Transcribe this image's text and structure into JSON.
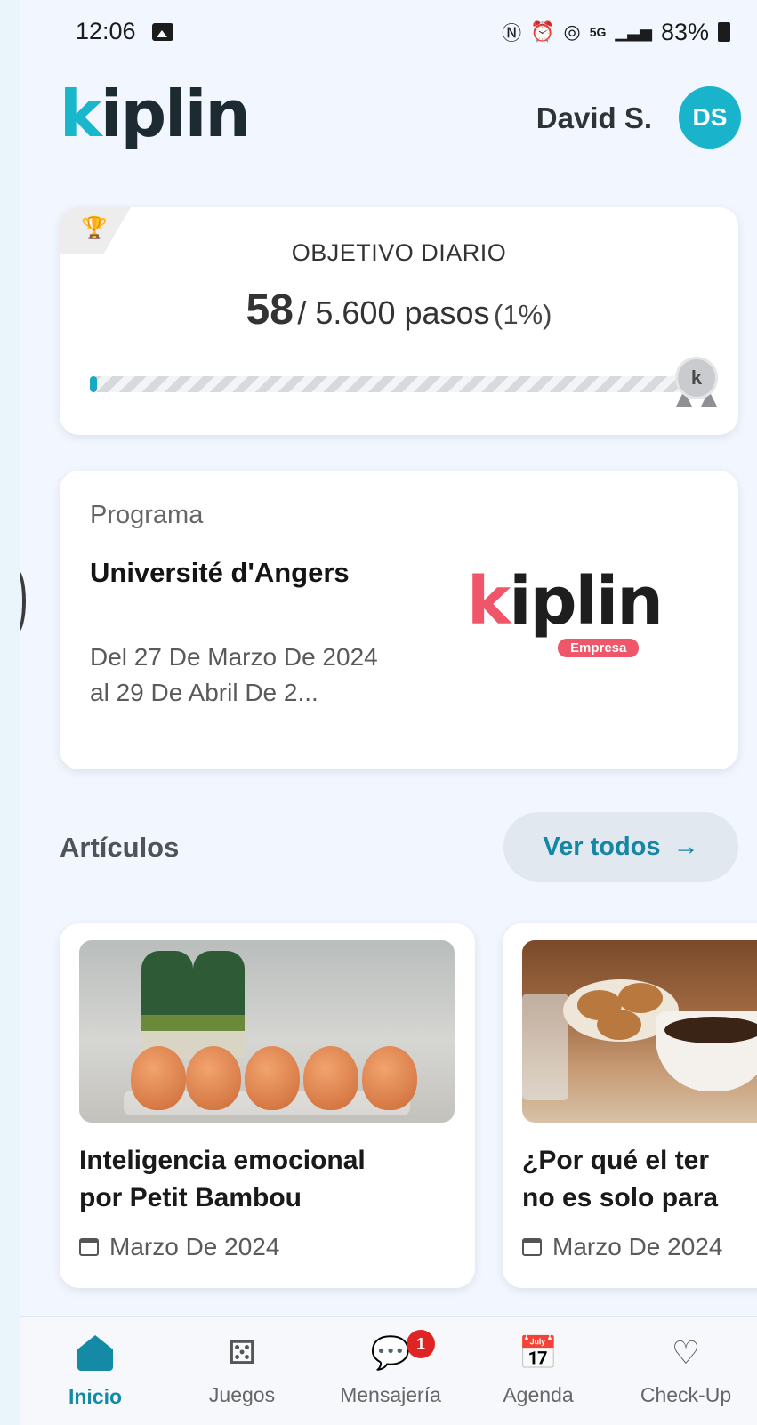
{
  "status_bar": {
    "time": "12:06",
    "battery": "83%",
    "icons": [
      "image-icon",
      "nfc-icon",
      "alarm-icon",
      "hotspot-icon",
      "5g-icon",
      "signal-icon",
      "battery-icon"
    ]
  },
  "header": {
    "logo_k": "k",
    "logo_rest": "iplin",
    "user_name": "David S.",
    "avatar_initials": "DS"
  },
  "goal": {
    "title": "OBJETIVO DIARIO",
    "steps": "58",
    "target_text": "/ 5.600 pasos",
    "percent_text": "(1%)",
    "progress_fraction": 0.01,
    "medal_letter": "k"
  },
  "program": {
    "label": "Programa",
    "name": "Université d'Angers",
    "dates_line1": "Del 27 De Marzo De 2024",
    "dates_line2": "al 29 De Abril De 2...",
    "logo_k": "k",
    "logo_rest": "iplin",
    "logo_badge": "Empresa"
  },
  "articles": {
    "section_title": "Artículos",
    "see_all_label": "Ver todos",
    "items": [
      {
        "title_line1": "Inteligencia emocional",
        "title_line2": "por Petit Bambou",
        "date": "Marzo De 2024"
      },
      {
        "title_line1": "¿Por qué el ter",
        "title_line2": "no es solo para",
        "date": "Marzo De 2024"
      }
    ]
  },
  "nav": {
    "items": [
      {
        "label": "Inicio",
        "icon": "home-icon",
        "active": true
      },
      {
        "label": "Juegos",
        "icon": "dice-icon",
        "active": false
      },
      {
        "label": "Mensajería",
        "icon": "chat-icon",
        "active": false,
        "badge": "1"
      },
      {
        "label": "Agenda",
        "icon": "calendar-icon",
        "active": false
      },
      {
        "label": "Check-Up",
        "icon": "heartbeat-icon",
        "active": false
      }
    ]
  },
  "colors": {
    "accent": "#18b7cc",
    "nav_active": "#148aa6",
    "brand_red": "#f0566a",
    "badge_red": "#e02424"
  }
}
